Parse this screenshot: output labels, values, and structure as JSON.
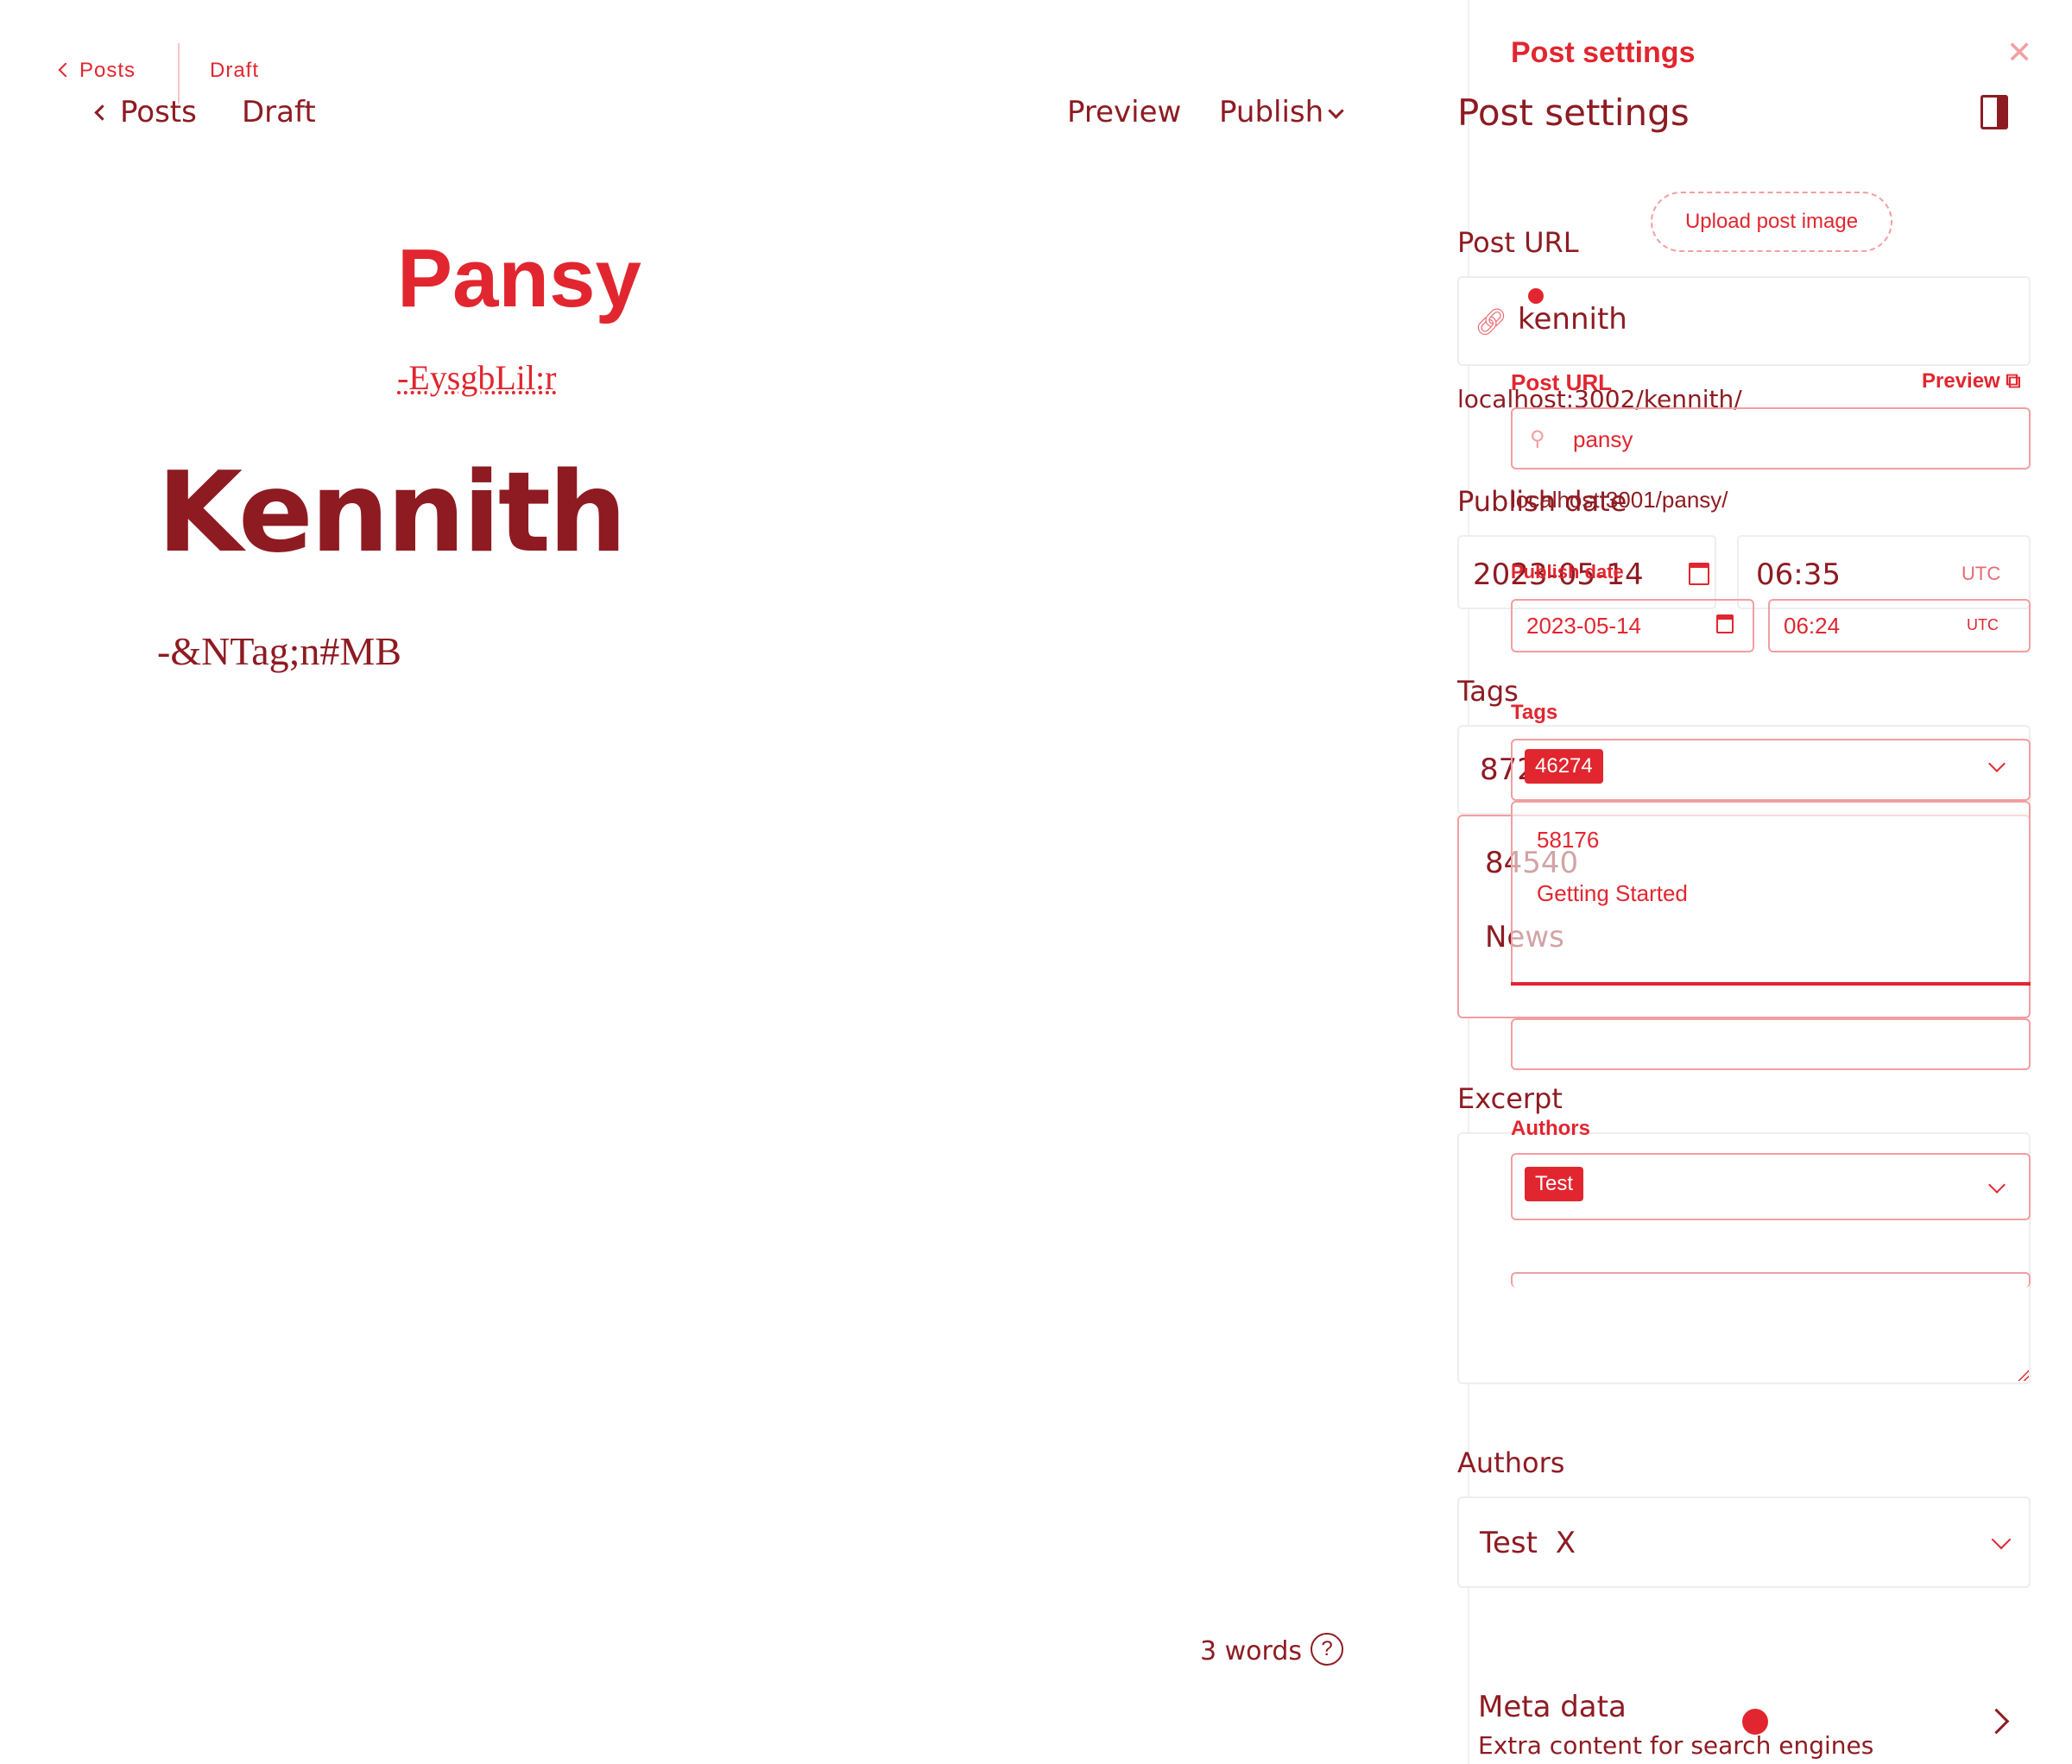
{
  "ghost_topbar": {
    "back_label": "Posts",
    "status": "Draft"
  },
  "topbar": {
    "back_label": "Posts",
    "status": "Draft",
    "preview_label": "Preview",
    "publish_label": "Publish"
  },
  "editor": {
    "ghost_title": "Pansy",
    "ghost_excerpt": "-EysgbLil:r",
    "title": "Kennith",
    "excerpt": "-&NTag;n#MB",
    "word_count": "3 words",
    "help_glyph": "?"
  },
  "ghost_panel": {
    "title": "Post settings",
    "upload_label": "Upload post image",
    "url_label": "Post URL",
    "url_preview_label": "Preview",
    "url_value": "pansy",
    "url_full": "localhost:3001/pansy/",
    "publish_date_label": "Publish date",
    "date_value": "2023-05-14",
    "time_value": "06:24",
    "tz": "UTC",
    "tags_label": "Tags",
    "tag_chip": "46274",
    "tag_options": [
      "58176",
      "Getting Started"
    ],
    "authors_label": "Authors",
    "author_chip": "Test"
  },
  "panel": {
    "title": "Post settings",
    "url_label": "Post URL",
    "url_value": "kennith",
    "url_full": "localhost:3002/kennith/",
    "publish_date_label": "Publish date",
    "date_value": "2023-05-14",
    "time_value": "06:35",
    "tz": "UTC",
    "tags_label": "Tags",
    "tag_value": "872",
    "tag_options": [
      "84540",
      "News"
    ],
    "excerpt_label": "Excerpt",
    "authors_label": "Authors",
    "author_value": "Test",
    "author_remove": "X",
    "meta_title": "Meta data",
    "meta_subtitle": "Extra content for search engines"
  },
  "colors": {
    "accent": "#e1262f",
    "dark_accent": "#8e1b22",
    "border": "#eeeeee"
  }
}
